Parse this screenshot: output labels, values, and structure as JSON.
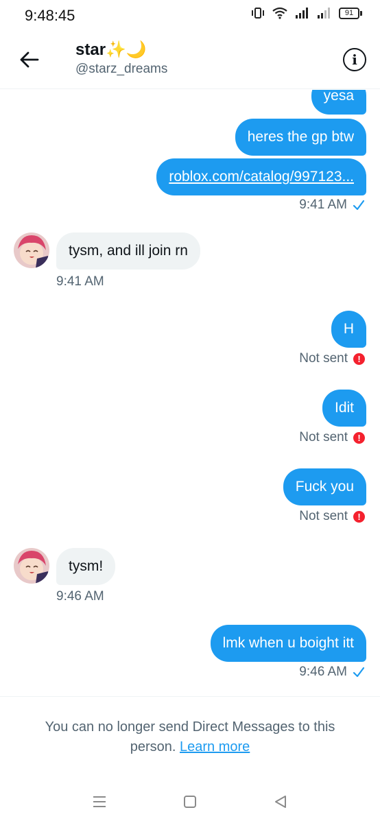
{
  "status_bar": {
    "time": "9:48:45",
    "battery": "91",
    "icons": [
      "vibrate-icon",
      "wifi-icon",
      "signal-icon",
      "signal-icon"
    ]
  },
  "header": {
    "name": "star✨🌙",
    "handle": "@starz_dreams",
    "back_icon": "arrow-left-icon",
    "info_icon": "info-icon"
  },
  "messages": [
    {
      "direction": "out",
      "text": "yesa"
    },
    {
      "direction": "out",
      "text": "heres the gp btw"
    },
    {
      "direction": "out",
      "text": "roblox.com/catalog/997123...",
      "is_link": true,
      "time": "9:41 AM",
      "status": "sent"
    },
    {
      "direction": "in",
      "text": "tysm, and ill join rn",
      "time": "9:41 AM"
    },
    {
      "direction": "out",
      "text": "H",
      "status_text": "Not sent"
    },
    {
      "direction": "out",
      "text": "Idit",
      "status_text": "Not sent"
    },
    {
      "direction": "out",
      "text": "Fuck you",
      "status_text": "Not sent"
    },
    {
      "direction": "in",
      "text": "tysm!",
      "time": "9:46 AM"
    },
    {
      "direction": "out",
      "text": "lmk when u boight itt",
      "time": "9:46 AM",
      "status": "sent"
    }
  ],
  "footer": {
    "notice": "You can no longer send Direct Messages to this person.",
    "link": "Learn more"
  },
  "nav_bar": {
    "icons": [
      "menu-icon",
      "home-square-icon",
      "back-triangle-icon"
    ]
  },
  "colors": {
    "accent": "#1d9bf0",
    "incoming_bubble": "#eff3f4",
    "muted_text": "#536471",
    "error": "#f4212e"
  }
}
